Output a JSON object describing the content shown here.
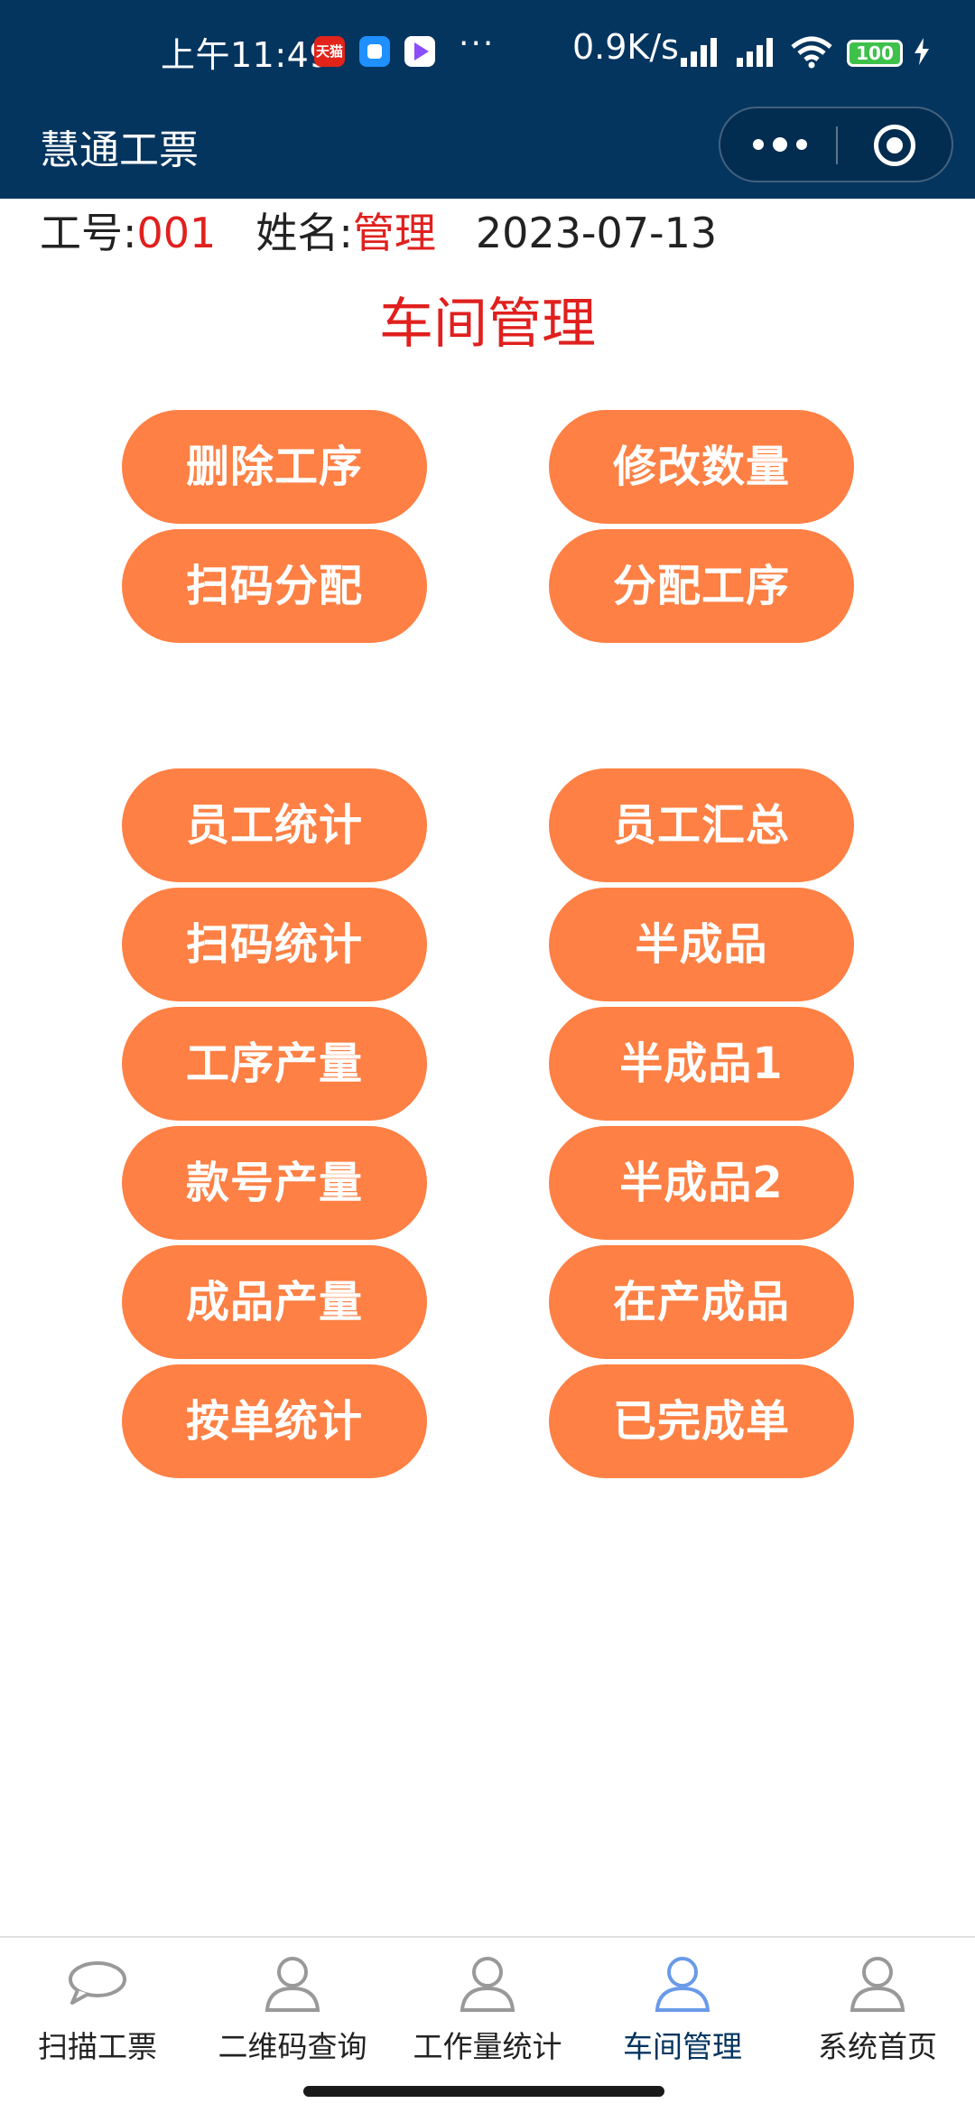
{
  "status_bar": {
    "time": "上午11:49",
    "tmall_label": "天猫",
    "more": "···",
    "net_speed": "0.9K/s",
    "battery": "100"
  },
  "nav": {
    "title": "慧通工票"
  },
  "info": {
    "job_label": "工号:",
    "job_value": "001",
    "name_label": "姓名:",
    "name_value": "管理",
    "date": "2023-07-13"
  },
  "page_title": "车间管理",
  "buttons": {
    "delete_process": "删除工序",
    "modify_quantity": "修改数量",
    "scan_assign": "扫码分配",
    "assign_process": "分配工序",
    "employee_stats": "员工统计",
    "employee_summary": "员工汇总",
    "scan_stats": "扫码统计",
    "semi_finished": "半成品",
    "process_output": "工序产量",
    "semi_finished_1": "半成品1",
    "style_output": "款号产量",
    "semi_finished_2": "半成品2",
    "finished_output": "成品产量",
    "in_production": "在产成品",
    "order_stats": "按单统计",
    "completed_orders": "已完成单"
  },
  "tabs": [
    {
      "label": "扫描工票",
      "icon": "chat-bubble-icon"
    },
    {
      "label": "二维码查询",
      "icon": "user-icon"
    },
    {
      "label": "工作量统计",
      "icon": "user-icon"
    },
    {
      "label": "车间管理",
      "icon": "user-icon"
    },
    {
      "label": "系统首页",
      "icon": "user-icon"
    }
  ],
  "colors": {
    "header_bg": "#04355f",
    "button_bg": "#fe8044",
    "accent_red": "#e0201e",
    "active_tab_icon": "#6a9ae8"
  },
  "active_tab_index": 3
}
